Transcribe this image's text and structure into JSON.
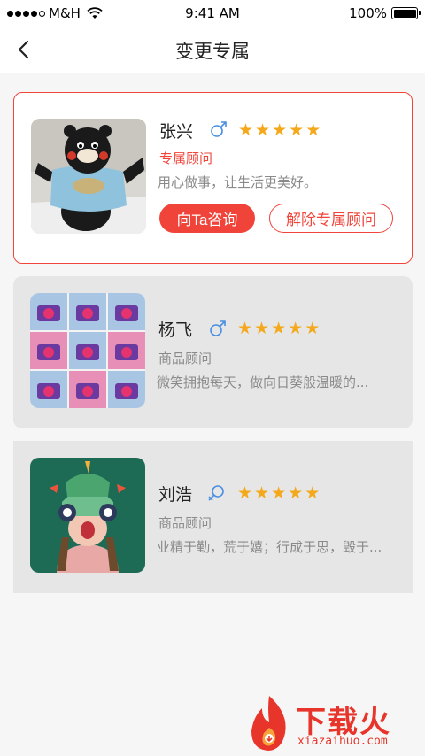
{
  "status_bar": {
    "carrier": "M&H",
    "time": "9:41 AM",
    "battery": "100%"
  },
  "nav": {
    "title": "变更专属",
    "back_icon": "chevron-left-icon"
  },
  "consultants": [
    {
      "name": "张兴",
      "gender": "male",
      "stars": 5,
      "role": "专属顾问",
      "motto": "用心做事，让生活更美好。",
      "selected": true,
      "consult_label": "向Ta咨询",
      "remove_label": "解除专属顾问"
    },
    {
      "name": "杨飞",
      "gender": "male",
      "stars": 5,
      "role": "商品顾问",
      "motto": "微笑拥抱每天，做向日葵般温暖的..."
    },
    {
      "name": "刘浩",
      "gender": "unspecified",
      "stars": 5,
      "role": "商品顾问",
      "motto": "业精于勤，荒于嬉；行成于思，毁于..."
    }
  ],
  "watermark": {
    "text": "下载火",
    "sub": "xiazaihuo.com"
  },
  "colors": {
    "accent": "#f0443a",
    "star": "#f4a91d",
    "gender_icon": "#4a90e2"
  }
}
